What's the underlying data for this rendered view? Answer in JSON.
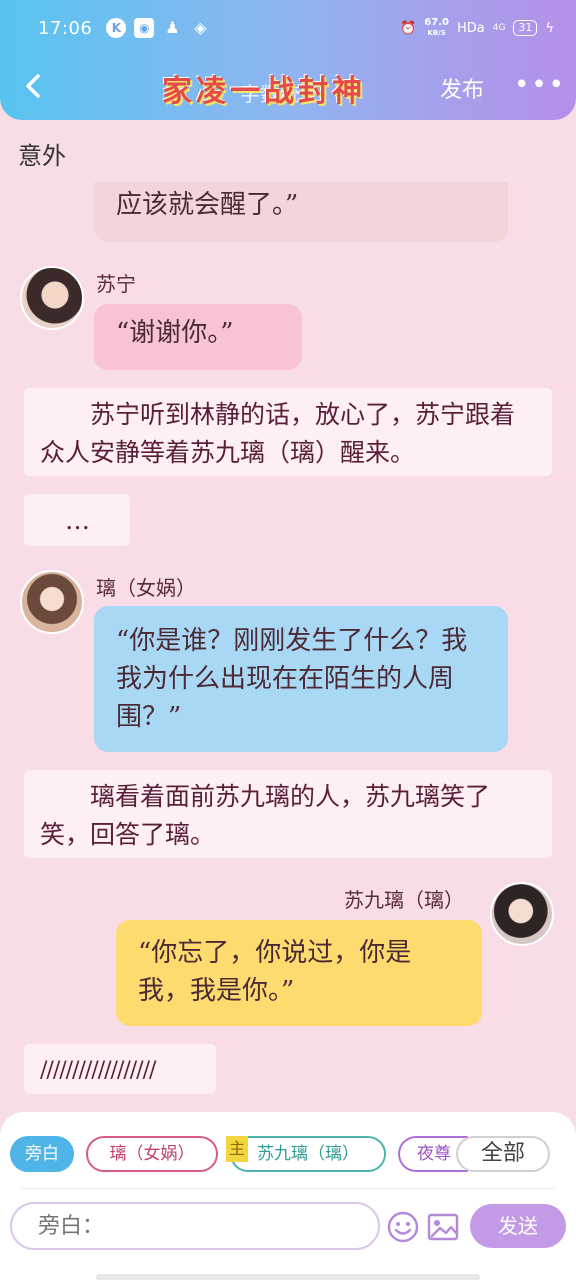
{
  "status_bar": {
    "time": "17:06",
    "net_speed_value": "67.0",
    "net_speed_unit": "KB/S",
    "hd": "HDa",
    "signal": "4G",
    "battery": "31"
  },
  "header": {
    "title_main": "家凌一战封神",
    "title_sub": "字数统计",
    "publish_label": "发布",
    "more_label": "•••"
  },
  "scene_label": "意外",
  "messages": [
    {
      "type": "bubble",
      "text": "应该就会醒了。”"
    },
    {
      "type": "dialog",
      "speaker": "苏宁",
      "text": "“谢谢你。”"
    },
    {
      "type": "narration",
      "text": "　　苏宁听到林静的话，放心了，苏宁跟着众人安静等着苏九璃（璃）醒来。"
    },
    {
      "type": "narration",
      "text": "　…"
    },
    {
      "type": "dialog",
      "speaker": "璃（女娲）",
      "text": "“你是谁？刚刚发生了什么？我我为什么出现在在陌生的人周围？”"
    },
    {
      "type": "narration",
      "text": "　　璃看着面前苏九璃的人，苏九璃笑了笑，回答了璃。"
    },
    {
      "type": "dialog",
      "speaker": "苏九璃（璃）",
      "text": "“你忘了，你说过，你是我，我是你。”"
    },
    {
      "type": "narration",
      "text": "//////////////////"
    }
  ],
  "roles": {
    "narrator": "旁白",
    "ru": "璃（女娲）",
    "main_tag": "主",
    "su": "苏九璃（璃）",
    "ye": "夜尊",
    "all": "全部"
  },
  "composer": {
    "placeholder": "旁白：",
    "send_label": "发送"
  },
  "colors": {
    "header_gradient": [
      "#57c4f0",
      "#b68fe8"
    ],
    "bubble_pink": "#f8c3d3",
    "bubble_blue": "#a9d8f5",
    "bubble_yellow": "#fddb6e",
    "send": "#c29ae6"
  }
}
